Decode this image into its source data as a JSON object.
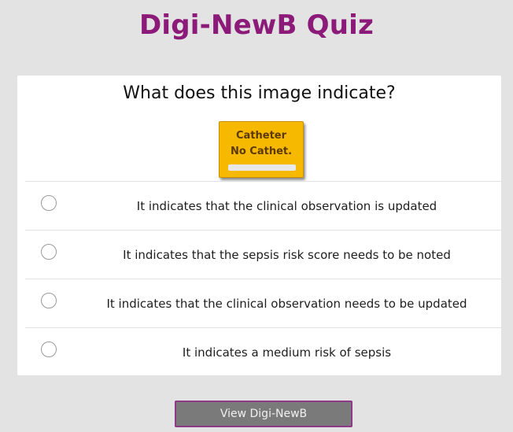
{
  "app": {
    "title": "Digi-NewB Quiz",
    "accent_color": "#8b1a78"
  },
  "quiz": {
    "question": "What does this image indicate?",
    "badge": {
      "line1": "Catheter",
      "line2": "No Cathet.",
      "color": "#f7b800"
    },
    "options": [
      {
        "label": "It indicates that the clinical observation is updated",
        "selected": false
      },
      {
        "label": "It indicates that the sepsis risk score needs to be noted",
        "selected": false
      },
      {
        "label": "It indicates that the clinical observation needs to be updated",
        "selected": false
      },
      {
        "label": "It indicates a medium risk of sepsis",
        "selected": false
      }
    ]
  },
  "footer": {
    "view_button_label": "View Digi-NewB"
  }
}
